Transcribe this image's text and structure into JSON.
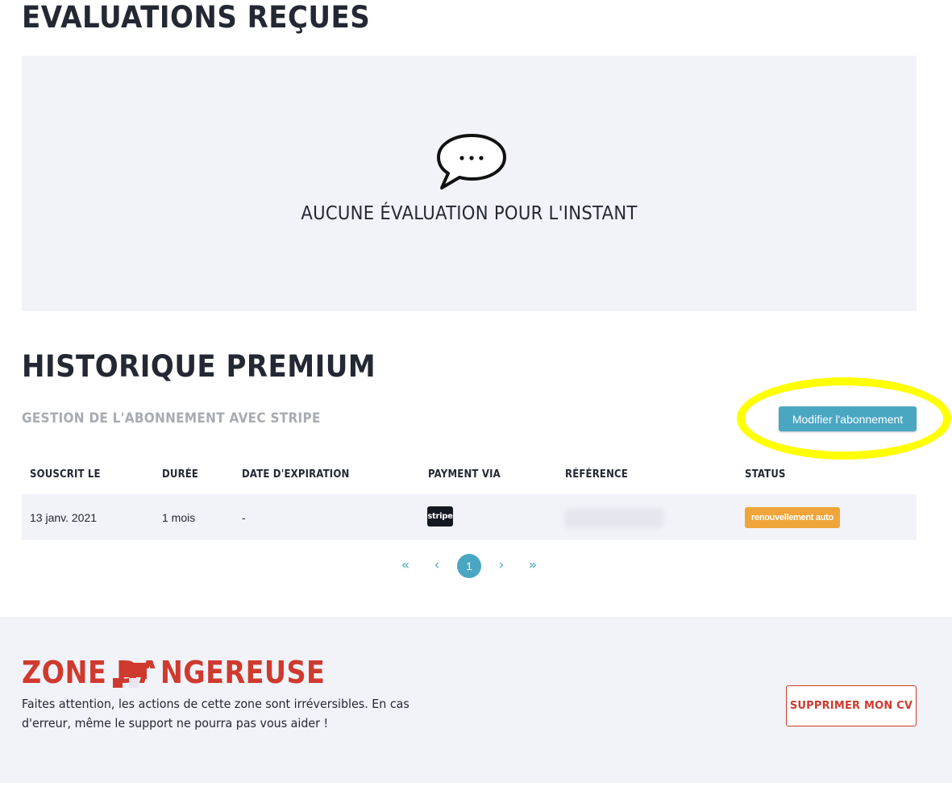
{
  "reviews": {
    "title": "EVALUATIONS REÇUES",
    "empty_icon": "speech-bubble-ellipsis-icon",
    "empty_text": "AUCUNE ÉVALUATION POUR L'INSTANT"
  },
  "premium": {
    "title": "HISTORIQUE PREMIUM",
    "subtitle": "GESTION DE L'ABONNEMENT AVEC STRIPE",
    "modify_button": "Modifier l'abonnement",
    "highlight_color": "#ffff00",
    "accent_color": "#4aa7c2",
    "columns": [
      "SOUSCRIT LE",
      "DURÉE",
      "DATE D'EXPIRATION",
      "PAYMENT VIA",
      "RÉFÉRENCE",
      "STATUS"
    ],
    "rows": [
      {
        "subscribed": "13 janv. 2021",
        "duration": "1 mois",
        "expiration": "-",
        "payment_logo": "stripe",
        "reference": "",
        "status": "renouvellement auto",
        "status_color": "#f0a53a"
      }
    ],
    "pagination": {
      "first": "«",
      "prev": "‹",
      "current": "1",
      "next": "›",
      "last": "»"
    }
  },
  "danger": {
    "title": "ZONE DANGEREUSE",
    "text": "Faites attention, les actions de cette zone sont irréversibles. En cas d'erreur, même le support ne pourra pas vous aider !",
    "delete_button": "SUPPRIMER MON CV",
    "color": "#cf3a2e"
  }
}
